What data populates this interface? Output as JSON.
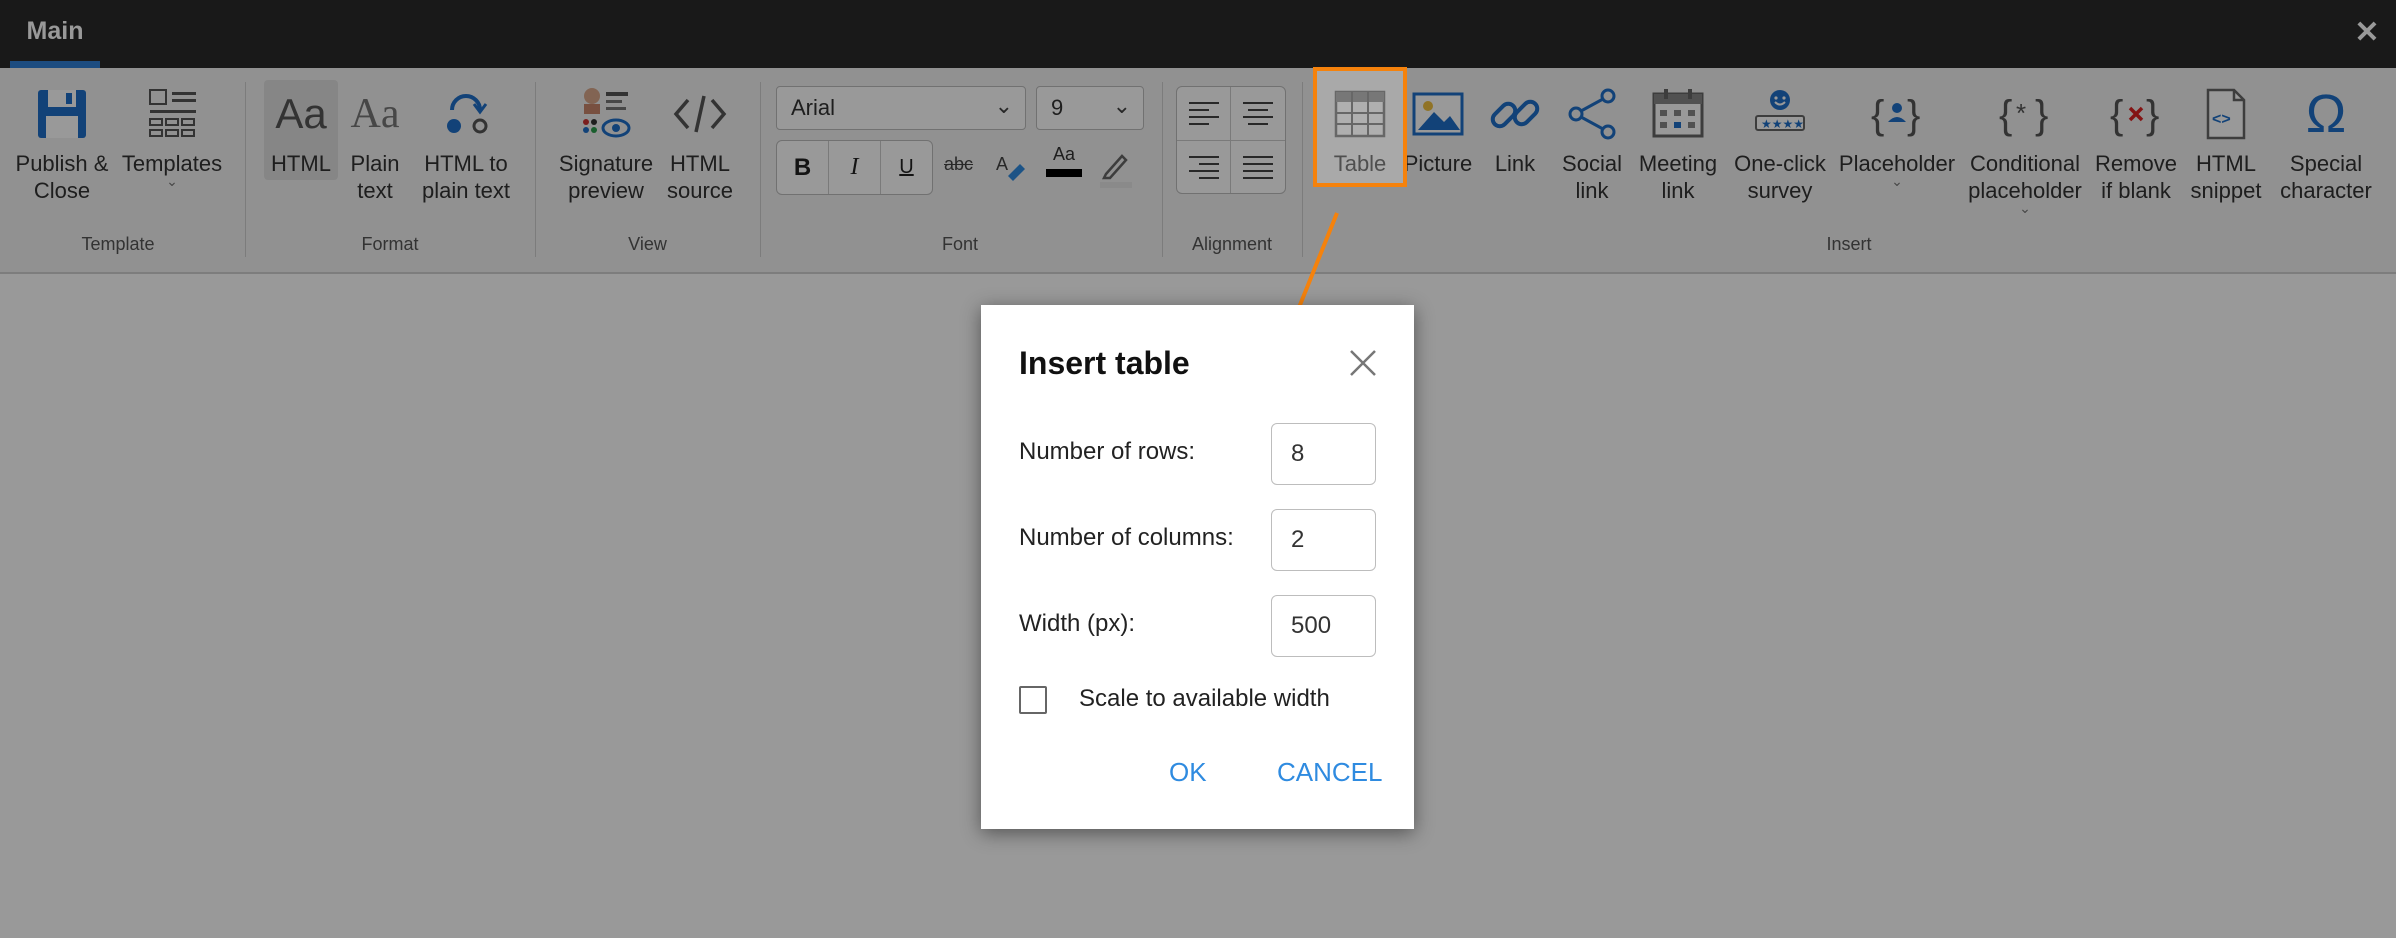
{
  "window": {
    "tab_label": "Main"
  },
  "ribbon": {
    "groups": {
      "template": "Template",
      "format": "Format",
      "view": "View",
      "font": "Font",
      "alignment": "Alignment",
      "insert": "Insert"
    },
    "buttons": {
      "publish": [
        "Publish &",
        "Close"
      ],
      "templates": [
        "Templates"
      ],
      "html": [
        "HTML"
      ],
      "plain_text": [
        "Plain",
        "text"
      ],
      "html_to_plain": [
        "HTML to",
        "plain text"
      ],
      "signature_preview": [
        "Signature",
        "preview"
      ],
      "html_source": [
        "HTML",
        "source"
      ],
      "table": [
        "Table"
      ],
      "picture": [
        "Picture"
      ],
      "link": [
        "Link"
      ],
      "social_link": [
        "Social",
        "link"
      ],
      "meeting_link": [
        "Meeting",
        "link"
      ],
      "survey": [
        "One-click",
        "survey"
      ],
      "placeholder": [
        "Placeholder"
      ],
      "conditional": [
        "Conditional",
        "placeholder"
      ],
      "remove_blank": [
        "Remove",
        "if blank"
      ],
      "html_snippet": [
        "HTML",
        "snippet"
      ],
      "special_char": [
        "Special",
        "character"
      ]
    },
    "font": {
      "family": "Arial",
      "size": "9",
      "bold": "B",
      "italic": "I",
      "underline": "U",
      "strike": "abc",
      "font_color": "Aa"
    }
  },
  "dialog": {
    "title": "Insert table",
    "rows_label": "Number of rows:",
    "rows_value": "8",
    "cols_label": "Number of columns:",
    "cols_value": "2",
    "width_label": "Width (px):",
    "width_value": "500",
    "scale_label": "Scale to available width",
    "ok": "OK",
    "cancel": "CANCEL"
  },
  "colors": {
    "accent": "#f5820c",
    "link_blue": "#2f8be0",
    "titlebar": "#2b2b2b"
  }
}
